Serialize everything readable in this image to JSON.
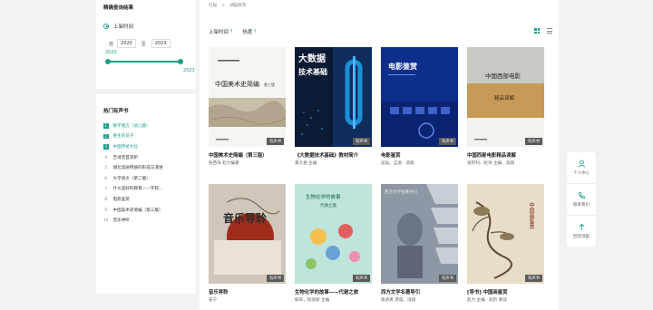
{
  "filter": {
    "title": "精确查询结果",
    "time_label": "上架时间",
    "from_label": "自",
    "from_year": "2020",
    "to_label": "至",
    "to_year": "2023",
    "slider_min": "2020",
    "slider_max": "2023"
  },
  "hot": {
    "title": "热门有声书",
    "items": [
      {
        "rank": "1",
        "title": "数字我方（幼儿版）"
      },
      {
        "rank": "2",
        "title": "重生的日子"
      },
      {
        "rank": "3",
        "title": "中国传统文化"
      },
      {
        "rank": "4",
        "title": "吉诗音首赏析"
      },
      {
        "rank": "5",
        "title": "湖北高层特质的形成与演进"
      },
      {
        "rank": "6",
        "title": "大学语文（第二版）"
      },
      {
        "rank": "7",
        "title": "什么是好的教育——学校..."
      },
      {
        "rank": "8",
        "title": "电影鉴赏"
      },
      {
        "rank": "9",
        "title": "中国美术史简编（第三版）"
      },
      {
        "rank": "10",
        "title": "音乐导听"
      }
    ]
  },
  "breadcrumb": {
    "home": "社猫",
    "sep": ">",
    "current": "湖猫教育"
  },
  "sort": {
    "time_label": "上架时间",
    "hot_label": "热度",
    "arrow": "↑"
  },
  "badge_label": "有声书",
  "books": [
    {
      "title": "中国美术史简编（第三版）",
      "author": "张西祥 赵力编著",
      "cover_title": "中国美术史简编",
      "cover_edition": "第三版"
    },
    {
      "title": "《大数据技术基础》教材简介",
      "author": "黄九君 主编",
      "cover_title_1": "大数据",
      "cover_title_2": "技术基础"
    },
    {
      "title": "电影鉴赏",
      "author": "吴灿、孟丽 · 滨翔",
      "cover_title": "电影鉴赏"
    },
    {
      "title": "中国西部电影精品读解",
      "author": "张阿利、赵涛 主编、滨翔",
      "cover_title": "中国西部电影",
      "cover_sub": "精品读解"
    },
    {
      "title": "音乐导聆",
      "author": "安宁",
      "cover_title": "音乐导聆"
    },
    {
      "title": "生物化学的故事——代谢之旅",
      "author": "解军，程丽丽 主编",
      "cover_title": "生物化学的故事",
      "cover_sub": "代谢之旅"
    },
    {
      "title": "西方文学名著导引",
      "author": "蒋承勇 龚咸、滨翔",
      "cover_title": "西方文学名著导引"
    },
    {
      "title": "[导书] 中国画鉴赏",
      "author": "赵力 主编 · 赵阶 解读",
      "cover_title": "中国画鉴赏"
    }
  ],
  "float_bar": {
    "user": "个人中心",
    "contact": "联系我们",
    "top": "回到顶部"
  },
  "colors": {
    "accent": "#1a9e8a",
    "page_bg": "#f1f2f4"
  }
}
